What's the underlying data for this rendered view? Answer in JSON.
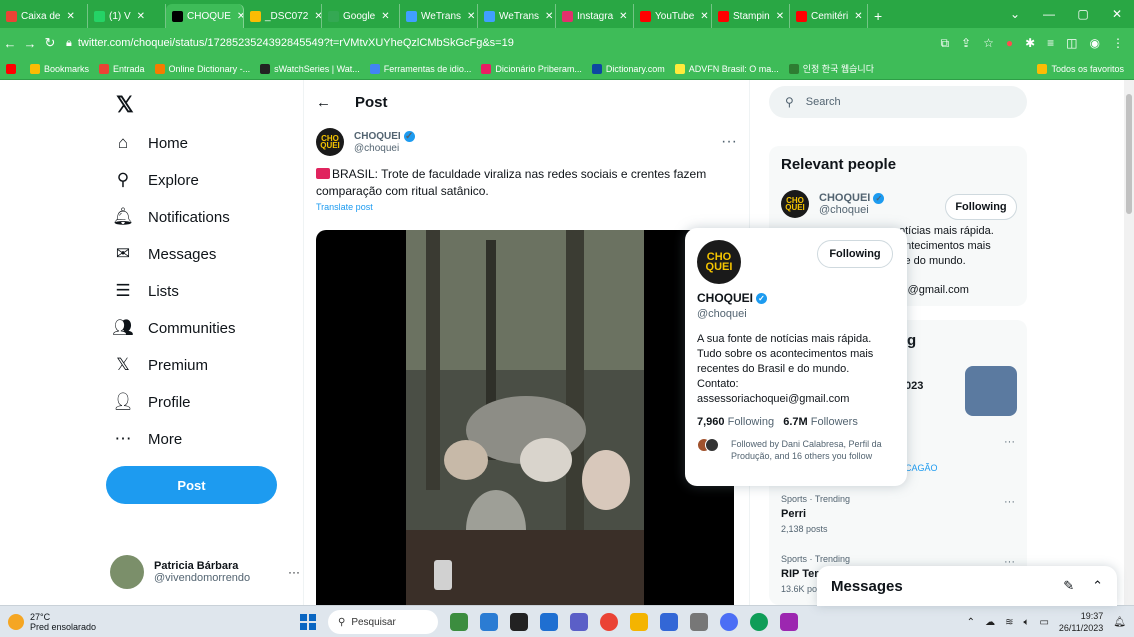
{
  "browser": {
    "tabs": [
      {
        "label": "Caixa de",
        "color": "#ea4335"
      },
      {
        "label": "(1) V",
        "color": "#25d366"
      },
      {
        "label": "CHOQUE",
        "color": "#000000"
      },
      {
        "label": "_DSC072",
        "color": "#fbbc04"
      },
      {
        "label": "Google",
        "color": "#34a853"
      },
      {
        "label": "WeTrans",
        "color": "#409fff"
      },
      {
        "label": "WeTrans",
        "color": "#409fff"
      },
      {
        "label": "Instagra",
        "color": "#e1306c"
      },
      {
        "label": "YouTube",
        "color": "#ff0000"
      },
      {
        "label": "Stampin",
        "color": "#ff0000"
      },
      {
        "label": "Cemitéri",
        "color": "#ff0000"
      }
    ],
    "new_tab": "+",
    "url": "twitter.com/choquei/status/1728523524392845549?t=rVMtvXUYheQzlCMbSkGcFg&s=19",
    "bookmarks": [
      {
        "label": "Bookmarks",
        "color": "#fbbc04"
      },
      {
        "label": "Entrada",
        "color": "#ea4335"
      },
      {
        "label": "Online Dictionary -...",
        "color": "#f57c00"
      },
      {
        "label": "sWatchSeries | Wat...",
        "color": "#222222"
      },
      {
        "label": "Ferramentas de idio...",
        "color": "#4285f4"
      },
      {
        "label": "Dicionário Priberam...",
        "color": "#e91e63"
      },
      {
        "label": "Dictionary.com",
        "color": "#0d47a1"
      },
      {
        "label": "ADVFN Brasil: O ma...",
        "color": "#ffeb3b"
      },
      {
        "label": "인정 한국 웹습니다",
        "color": "#2e7d32"
      }
    ],
    "all_bookmarks": "Todos os favoritos"
  },
  "nav": {
    "logo": "𝕏",
    "items": [
      {
        "label": "Home",
        "icon": "⌂"
      },
      {
        "label": "Explore",
        "icon": "⚲"
      },
      {
        "label": "Notifications",
        "icon": "🔔︎"
      },
      {
        "label": "Messages",
        "icon": "✉"
      },
      {
        "label": "Lists",
        "icon": "☰"
      },
      {
        "label": "Communities",
        "icon": "👥︎"
      },
      {
        "label": "Premium",
        "icon": "𝕏"
      },
      {
        "label": "Profile",
        "icon": "👤︎"
      },
      {
        "label": "More",
        "icon": "⋯"
      }
    ],
    "post_button": "Post",
    "user": {
      "name": "Patricia Bárbara",
      "handle": "@vivendomorrendo",
      "more": "···"
    }
  },
  "main": {
    "back": "←",
    "title": "Post",
    "tweet": {
      "name": "CHOQUEI",
      "handle": "@choquei",
      "more": "···",
      "avatar_text": "CHO QUEI",
      "text": "BRASIL: Trote de faculdade viraliza nas redes sociais e crentes fazem comparação com ritual satânico.",
      "translate": "Translate post"
    }
  },
  "right": {
    "search_placeholder": "Search",
    "relevant": {
      "title": "Relevant people",
      "name": "CHOQUEI",
      "handle": "@choquei",
      "follow": "Following",
      "bio_peek_1": "otícias mais rápida.",
      "bio_peek_2": "ontecimentos mais",
      "bio_peek_3": "l e do mundo.",
      "bio_peek_4": "ei@gmail.com"
    },
    "trends": [
      {
        "cat": "",
        "name": "023",
        "count": "",
        "dots": "···"
      },
      {
        "cat": "Sports · Trending",
        "name": "Perri",
        "count": "2,138 posts",
        "dots": "···"
      },
      {
        "cat": "Sports · Trending",
        "name": "RIP Ter",
        "count": "13.6K po",
        "dots": "···"
      }
    ],
    "trend_partial_g": "g",
    "trend_partial_link": "CAGÃO"
  },
  "hovercard": {
    "name": "CHOQUEI",
    "handle": "@choquei",
    "follow": "Following",
    "avatar_text": "CHO QUEI",
    "bio": "A sua fonte de notícias mais rápida. Tudo sobre os acontecimentos mais recentes do Brasil e do mundo. Contato: assessoriachoquei@gmail.com",
    "following_count": "7,960",
    "following_label": "Following",
    "followers_count": "6.7M",
    "followers_label": "Followers",
    "followed_by": "Followed by Dani Calabresa, Perfil da Produção, and 16 others you follow"
  },
  "messages_drawer": {
    "title": "Messages"
  },
  "taskbar": {
    "temp": "27°C",
    "weather": "Pred ensolarado",
    "search": "Pesquisar",
    "time": "19:37",
    "date": "26/11/2023"
  }
}
